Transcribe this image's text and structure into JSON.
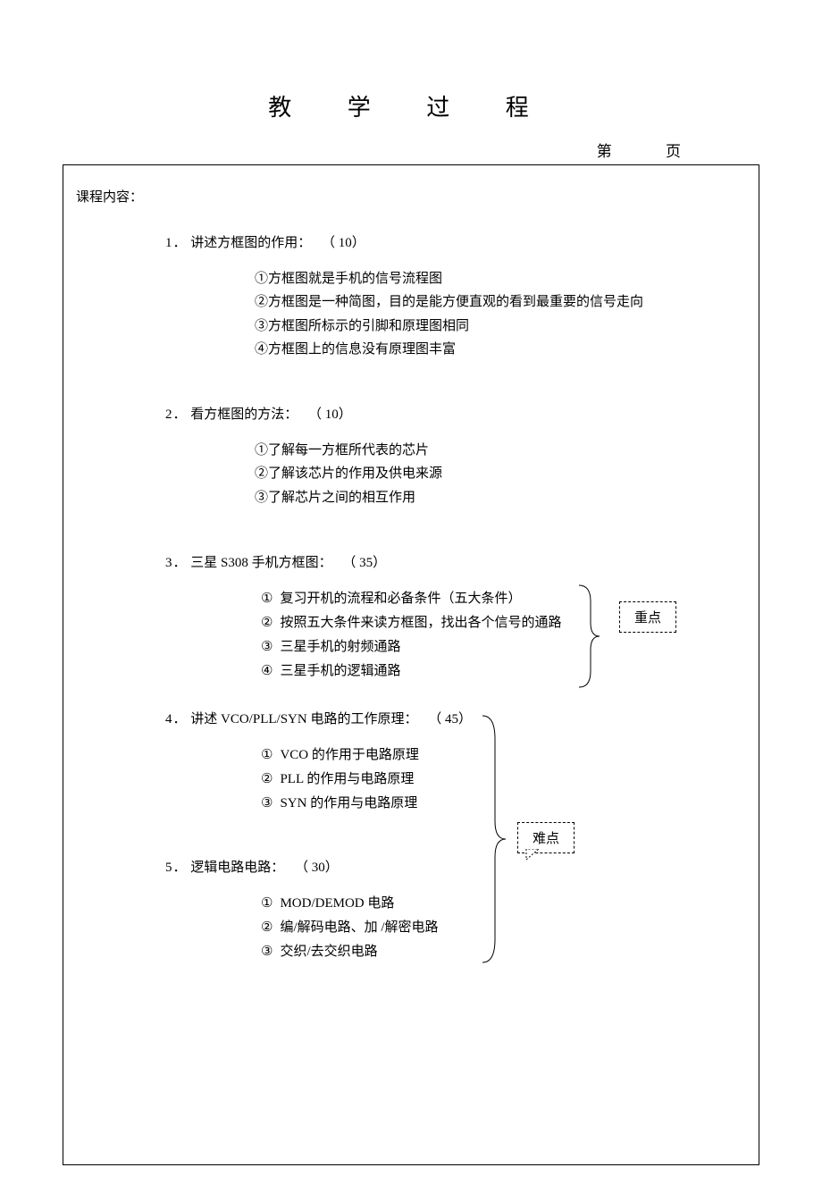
{
  "title": "教 学 过 程",
  "page_label": "第 页",
  "course_label": "课程内容：",
  "callouts": {
    "key": "重点",
    "hard": "难点"
  },
  "sections": [
    {
      "num": "1．",
      "title": "讲述方框图的作用：",
      "minutes": "（ 10）",
      "items_style": "circled",
      "items": [
        "①方框图就是手机的信号流程图",
        "②方框图是一种简图，目的是能方便直观的看到最重要的信号走向",
        "③方框图所标示的引脚和原理图相同",
        "④方框图上的信息没有原理图丰富"
      ]
    },
    {
      "num": "2．",
      "title": "看方框图的方法：",
      "minutes": "（ 10）",
      "items_style": "circled",
      "items": [
        "①了解每一方框所代表的芯片",
        "②了解该芯片的作用及供电来源",
        "③了解芯片之间的相互作用"
      ]
    },
    {
      "num": "3．",
      "title": "三星  S308 手机方框图：",
      "minutes": "（ 35）",
      "items_style": "spaced",
      "items": [
        {
          "marker": "①",
          "text": "复习开机的流程和必备条件（五大条件）"
        },
        {
          "marker": "②",
          "text": "按照五大条件来读方框图，找出各个信号的通路"
        },
        {
          "marker": "③",
          "text": "三星手机的射频通路"
        },
        {
          "marker": "④",
          "text": "三星手机的逻辑通路"
        }
      ]
    },
    {
      "num": "4．",
      "title": "讲述 VCO/PLL/SYN    电路的工作原理：",
      "minutes": "（ 45）",
      "items_style": "spaced",
      "items": [
        {
          "marker": "①",
          "text": "VCO 的作用于电路原理"
        },
        {
          "marker": "②",
          "text": "PLL 的作用与电路原理"
        },
        {
          "marker": "③",
          "text": "SYN 的作用与电路原理"
        }
      ]
    },
    {
      "num": "5．",
      "title": "逻辑电路电路：",
      "minutes": "（ 30）",
      "items_style": "spaced",
      "items": [
        {
          "marker": "①",
          "text": "MOD/DEMOD    电路"
        },
        {
          "marker": "②",
          "text": "编/解码电路、加  /解密电路"
        },
        {
          "marker": "③",
          "text": "交织/去交织电路"
        }
      ]
    }
  ]
}
